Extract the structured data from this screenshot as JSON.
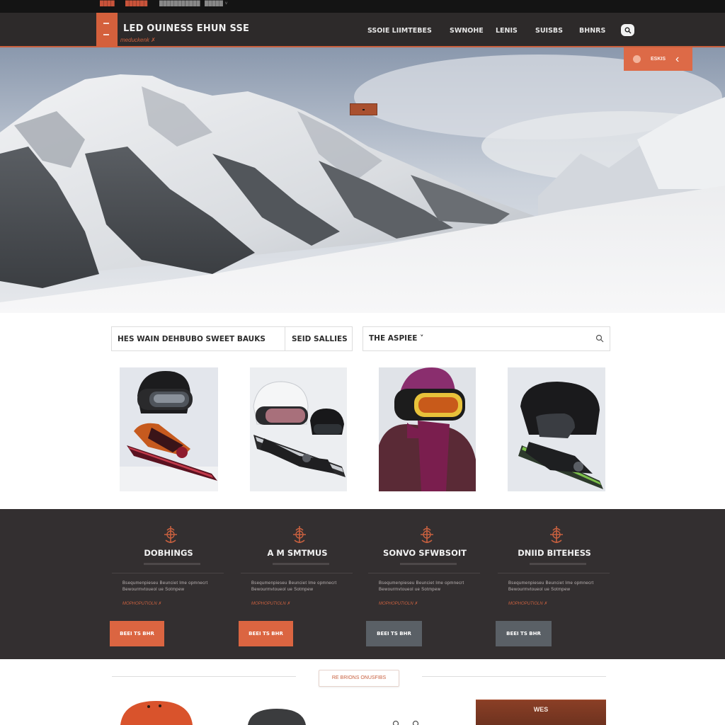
{
  "topbar": {
    "items": [
      "████",
      "██████",
      "███████████",
      "█████  ˅"
    ]
  },
  "header": {
    "brand": "LED OUINESS EHUN SSE",
    "tagline": "meduckenk ✗",
    "nav": [
      "SSOIE LIIMTEBES",
      "SWNOHE",
      "LENIS",
      "SUISBS",
      "BHNRS"
    ],
    "search_icon": "search-icon"
  },
  "hero": {
    "cta_label": "ESKIS",
    "cta_chevron": "‹",
    "image_desc_icon": "mountain-photo"
  },
  "filter": {
    "left_label": "HES WAIN DEHBUBO SWEET BAUKS",
    "right_label": "SEID SALLIES",
    "search_value": "THE ASPIEE ˅"
  },
  "features": [
    {
      "title": "DOBHINGS",
      "link": "MOPHOPUTIOLN ✗",
      "button": "BEEI TS BHR",
      "button_style": "orange"
    },
    {
      "title": "A M SMTMUS",
      "link": "MOPHOPUTIOLN ✗",
      "button": "BEEI TS BHR",
      "button_style": "orange"
    },
    {
      "title": "SONVO SFWBSOIT",
      "link": "MOPHOPUTIOLN ✗",
      "button": "BEEI TS BHR",
      "button_style": "grey"
    },
    {
      "title": "DNIID BITEHESS",
      "link": "MOPHOPUTIOLN ✗",
      "button": "BEEI TS BHR",
      "button_style": "grey"
    }
  ],
  "feature_text": "Bsequmenpieseu Beunciet Ime opmnecrt Bewourmvtoueol ue Sotmpew",
  "bottom": {
    "section_label": "RE BRIONS ONUSFIBS",
    "promo_title": "WES"
  },
  "colors": {
    "accent": "#db6541",
    "dark_band": "#332f30",
    "nav_bg": "#2d2a2a"
  }
}
